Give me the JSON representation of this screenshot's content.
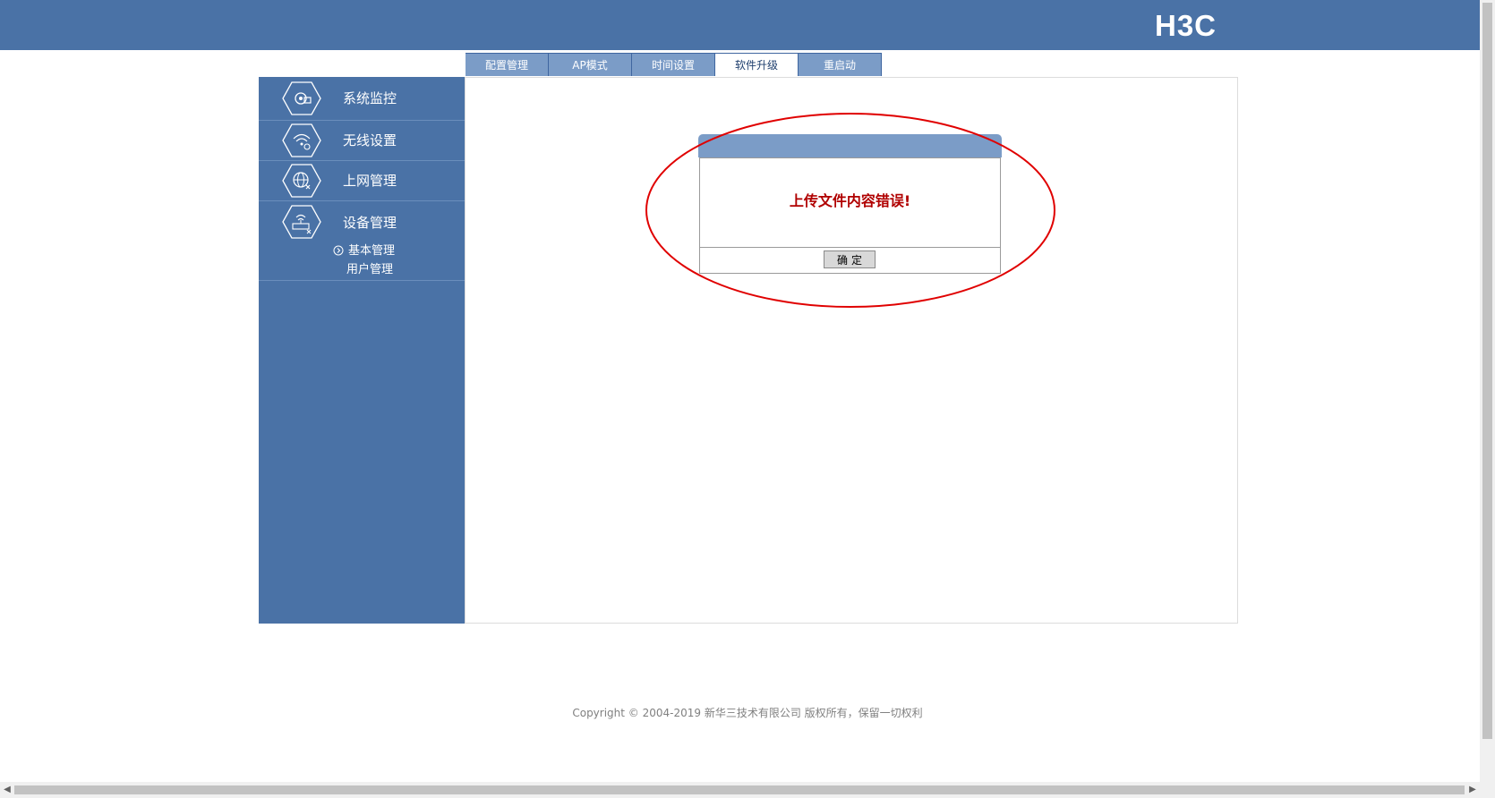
{
  "header": {
    "logo_text": "H3C"
  },
  "tabs": [
    {
      "label": "配置管理",
      "active": false
    },
    {
      "label": "AP模式",
      "active": false
    },
    {
      "label": "时间设置",
      "active": false
    },
    {
      "label": "软件升级",
      "active": true
    },
    {
      "label": "重启动",
      "active": false
    }
  ],
  "sidebar": {
    "items": [
      {
        "label": "系统监控",
        "icon": "gear-monitor-icon"
      },
      {
        "label": "无线设置",
        "icon": "wireless-icon"
      },
      {
        "label": "上网管理",
        "icon": "globe-icon"
      },
      {
        "label": "设备管理",
        "icon": "router-icon"
      }
    ],
    "sub_items": [
      {
        "label": "基本管理",
        "selected": true
      },
      {
        "label": "用户管理",
        "selected": false
      }
    ]
  },
  "dialog": {
    "message": "上传文件内容错误!",
    "ok_label": "确定"
  },
  "footer": {
    "copyright": "Copyright © 2004-2019 新华三技术有限公司 版权所有，保留一切权利"
  },
  "colors": {
    "brand_blue": "#4a72a6",
    "tab_blue": "#7b9cc7",
    "error_red": "#b00000",
    "annotation_red": "#e00000"
  }
}
